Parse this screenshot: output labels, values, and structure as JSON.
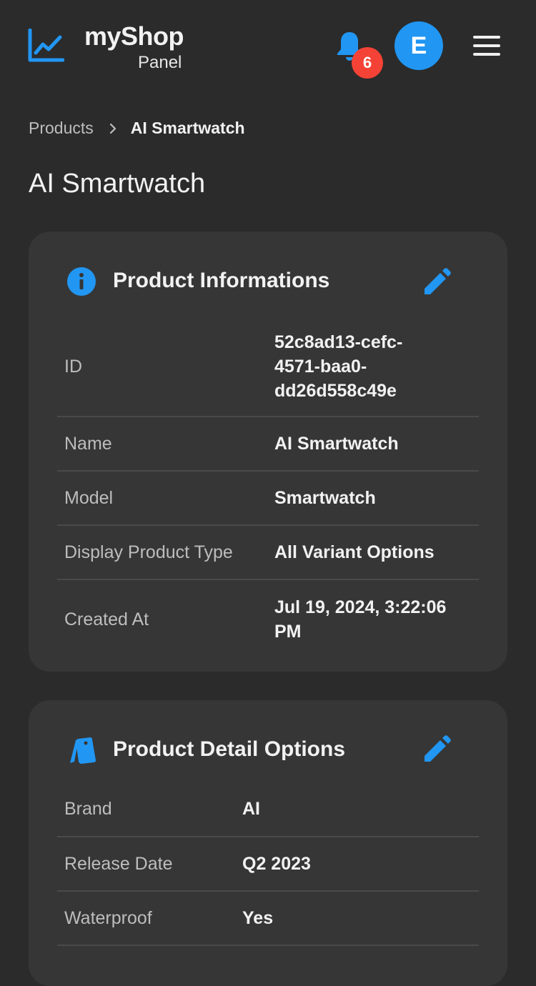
{
  "app": {
    "name": "myShop",
    "subtitle": "Panel"
  },
  "header": {
    "notification_count": "6",
    "avatar_initial": "E",
    "icons": [
      "chart-line-icon",
      "bell-icon",
      "menu-icon"
    ],
    "accent_color": "#2196f3",
    "badge_color": "#f44336"
  },
  "breadcrumb": {
    "parent": "Products",
    "current": "AI Smartwatch"
  },
  "page": {
    "title": "AI Smartwatch"
  },
  "info_card": {
    "title": "Product Informations",
    "icon": "info-icon",
    "rows": [
      {
        "label": "ID",
        "value": "52c8ad13-cefc-\n4571-baa0-\ndd26d558c49e"
      },
      {
        "label": "Name",
        "value": "AI Smartwatch"
      },
      {
        "label": "Model",
        "value": "Smartwatch"
      },
      {
        "label": "Display Product Type",
        "value": "All Variant Options"
      },
      {
        "label": "Created At",
        "value": "Jul 19, 2024, 3:22:06\nPM"
      }
    ]
  },
  "detail_card": {
    "title": "Product Detail Options",
    "icon": "tags-icon",
    "rows": [
      {
        "label": "Brand",
        "value": "AI"
      },
      {
        "label": "Release Date",
        "value": "Q2 2023"
      },
      {
        "label": "Waterproof",
        "value": "Yes"
      }
    ]
  }
}
